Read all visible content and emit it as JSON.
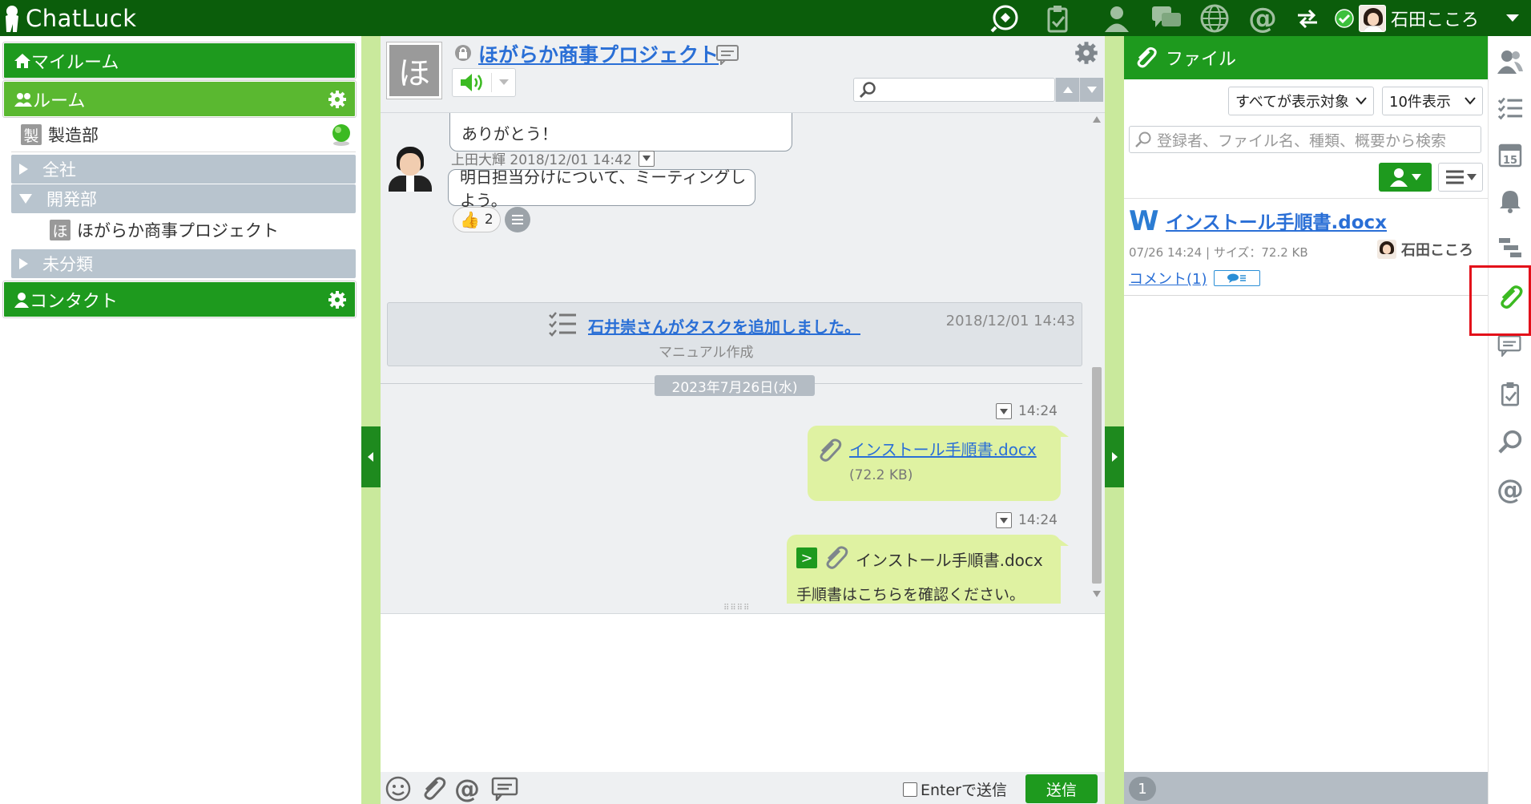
{
  "app": {
    "name": "ChatLuck"
  },
  "header": {
    "user_name": "石田こころ"
  },
  "left": {
    "my_room": "マイルーム",
    "rooms": "ルーム",
    "room_item": {
      "badge": "製",
      "label": "製造部"
    },
    "groups": [
      {
        "label": "全社",
        "state": "collapsed"
      },
      {
        "label": "開発部",
        "state": "expanded"
      },
      {
        "label": "未分類",
        "state": "collapsed"
      }
    ],
    "sub_room": {
      "badge": "ほ",
      "label": "ほがらか商事プロジェクト"
    },
    "contacts": "コンタクト"
  },
  "room": {
    "avatar_char": "ほ",
    "title": "ほがらか商事プロジェクト",
    "search_placeholder": ""
  },
  "messages": {
    "m1_text": "ありがとう！",
    "m2_sender_time": "上田大輝 2018/12/01 14:42",
    "m2_text": "明日担当分けについて、ミーティングしよう。",
    "m2_reaction_count": "2",
    "task_text": "石井崇さんがタスクを追加しました。",
    "task_sub": "マニュアル作成",
    "task_time": "2018/12/01 14:43",
    "date_divider": "2023年7月26日(水)",
    "m3_time": "14:24",
    "m3_file": "インストール手順書.docx",
    "m3_size": "(72.2 KB)",
    "m4_time": "14:24",
    "m4_file": "インストール手順書.docx",
    "m4_badge": ">",
    "m4_text": "手順書はこちらを確認ください。"
  },
  "composer": {
    "enter_label": "Enterで送信",
    "send": "送信"
  },
  "files": {
    "title": "ファイル",
    "filter_scope": "すべてが表示対象",
    "filter_count": "10件表示",
    "search_placeholder": "登録者、ファイル名、種類、概要から検索",
    "entry": {
      "type_char": "W",
      "name": "インストール手順書.docx",
      "meta": "07/26 14:24 | サイズ：72.2 KB",
      "owner": "石田こころ",
      "comment": "コメント(1)"
    },
    "page": "1"
  },
  "colors": {
    "brand_dark": "#0b5d0b",
    "brand": "#1e9a1e",
    "accent_light": "#c9e99c",
    "link": "#2a6fd6",
    "highlight": "#e3101a"
  }
}
